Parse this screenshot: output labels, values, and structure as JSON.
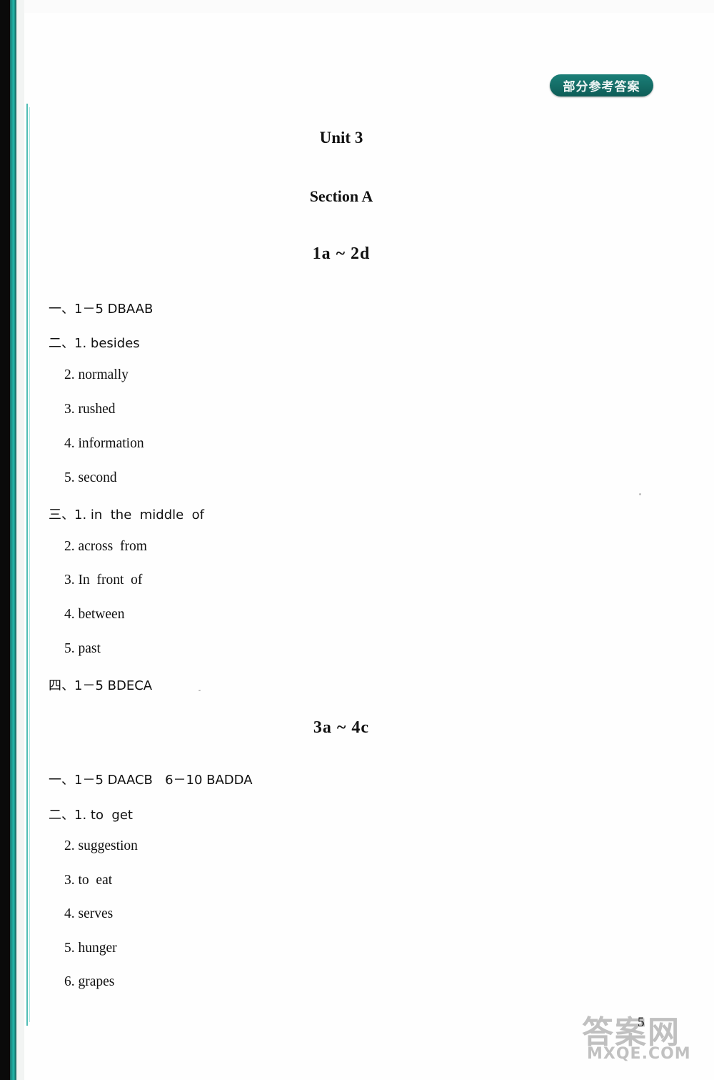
{
  "header": {
    "banner_label": "部分参考答案"
  },
  "headings": {
    "unit": "Unit 3",
    "section": "Section A",
    "sub1": "1a ~ 2d",
    "sub2": "3a ~ 4c"
  },
  "section_1a2d": {
    "lines": [
      "一、1－5 DBAAB",
      "二、1. besides",
      "2. normally",
      "3. rushed",
      "4. information",
      "5. second",
      "三、1. in  the  middle  of",
      "2. across  from",
      "3. In  front  of",
      "4. between",
      "5. past",
      "四、1－5 BDECA"
    ]
  },
  "section_3a4c": {
    "lines": [
      "一、1－5 DAACB   6－10 BADDA",
      "二、1. to  get",
      "2. suggestion",
      "3. to  eat",
      "4. serves",
      "5. hunger",
      "6. grapes"
    ]
  },
  "footer": {
    "page_number": "5",
    "watermark_cn": "答案网",
    "watermark_en": "MXQE.COM"
  }
}
